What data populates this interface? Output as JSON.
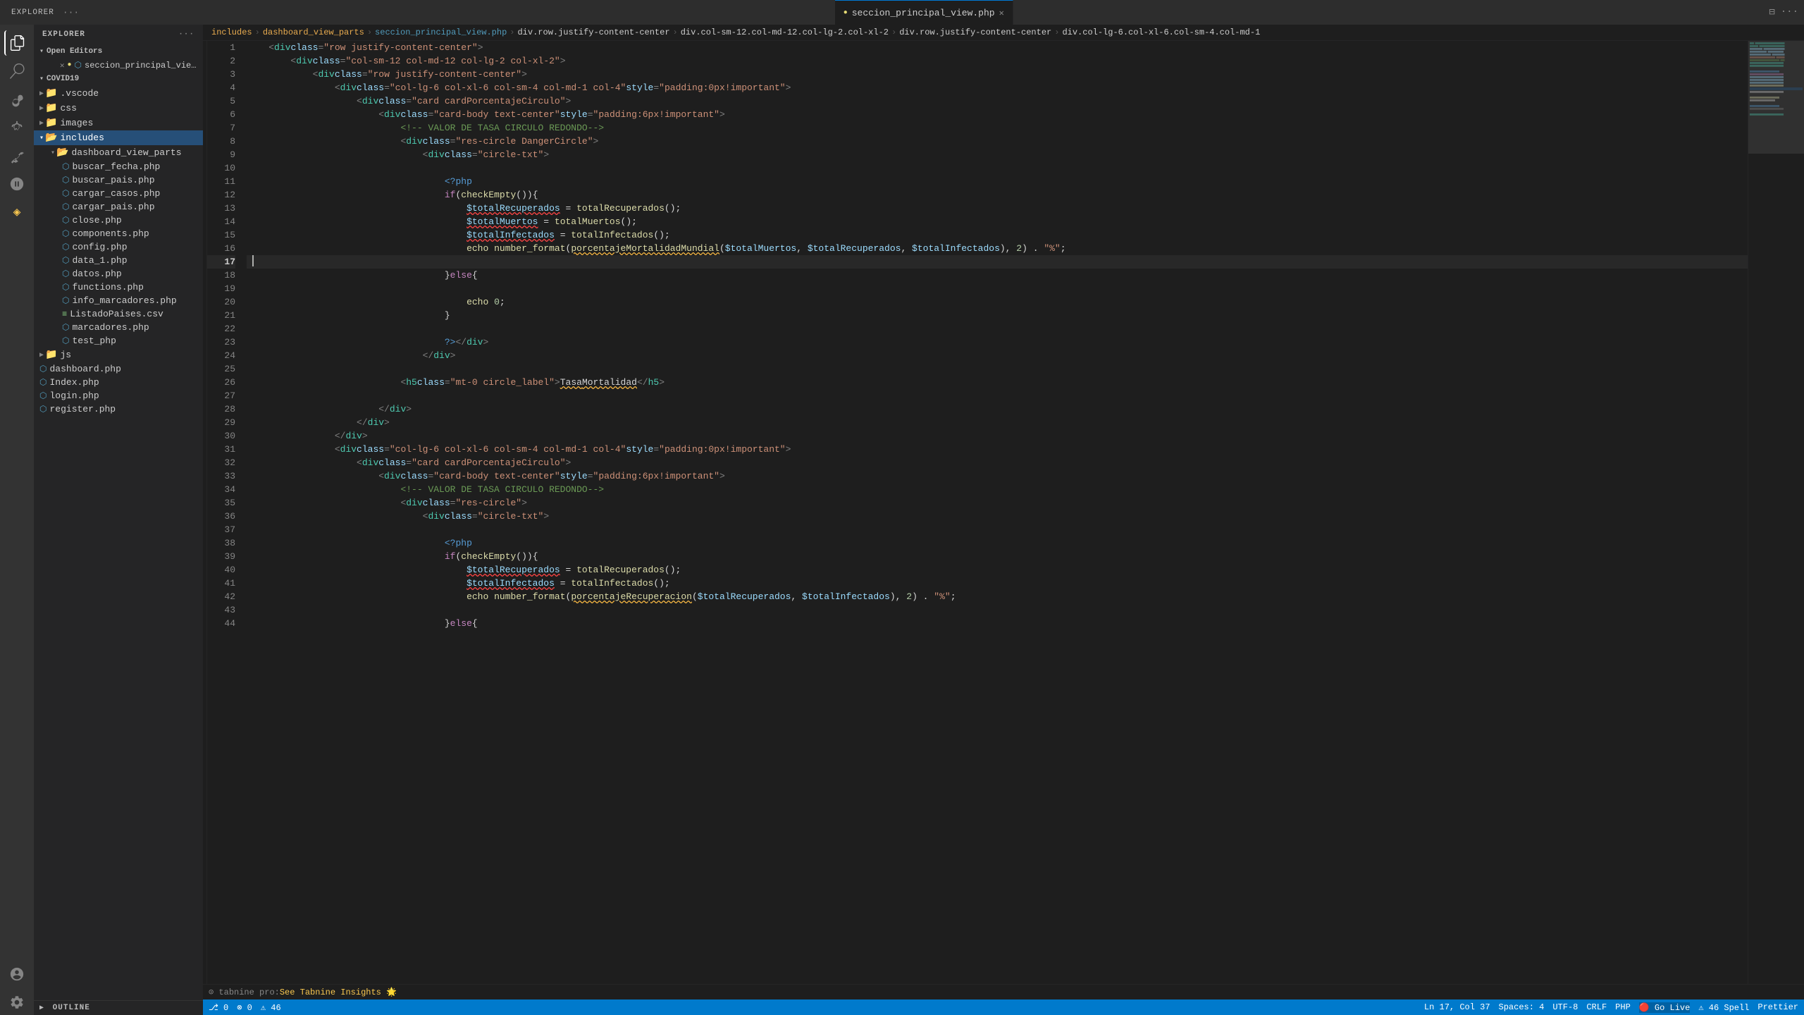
{
  "app": {
    "title": "VS Code - seccion_principal_view.php"
  },
  "activity_bar": {
    "icons": [
      {
        "name": "explorer-icon",
        "symbol": "⎘",
        "label": "Explorer",
        "active": true
      },
      {
        "name": "search-icon",
        "symbol": "🔍",
        "label": "Search"
      },
      {
        "name": "source-control-icon",
        "symbol": "⑂",
        "label": "Source Control"
      },
      {
        "name": "debug-icon",
        "symbol": "▶",
        "label": "Run and Debug"
      },
      {
        "name": "extensions-icon",
        "symbol": "⊞",
        "label": "Extensions"
      },
      {
        "name": "remote-explorer-icon",
        "symbol": "⌖",
        "label": "Remote Explorer"
      },
      {
        "name": "tabnine-icon",
        "symbol": "◈",
        "label": "Tabnine"
      }
    ],
    "bottom_icons": [
      {
        "name": "accounts-icon",
        "symbol": "👤",
        "label": "Accounts"
      },
      {
        "name": "settings-icon",
        "symbol": "⚙",
        "label": "Settings"
      }
    ]
  },
  "sidebar": {
    "header": "Explorer",
    "open_editors_label": "Open Editors",
    "open_editors": [
      {
        "name": "seccion_principal_view.php",
        "modified": true,
        "icon": "php-file-icon",
        "color": "#519aba"
      }
    ],
    "project_label": "COVID19",
    "tree": [
      {
        "indent": 0,
        "type": "folder",
        "label": ".vscode",
        "icon": "folder-icon",
        "expanded": false
      },
      {
        "indent": 0,
        "type": "folder",
        "label": "css",
        "icon": "folder-icon",
        "expanded": false
      },
      {
        "indent": 0,
        "type": "folder",
        "label": "images",
        "icon": "folder-icon",
        "expanded": false
      },
      {
        "indent": 0,
        "type": "folder",
        "label": "includes",
        "icon": "folder-icon",
        "expanded": true,
        "active": true
      },
      {
        "indent": 1,
        "type": "folder",
        "label": "dashboard_view_parts",
        "icon": "folder-icon",
        "expanded": true
      },
      {
        "indent": 2,
        "type": "file",
        "label": "buscar_fecha.php",
        "icon": "php-file-icon",
        "color": "#519aba"
      },
      {
        "indent": 2,
        "type": "file",
        "label": "buscar_pais.php",
        "icon": "php-file-icon",
        "color": "#519aba"
      },
      {
        "indent": 2,
        "type": "file",
        "label": "cargar_casos.php",
        "icon": "php-file-icon",
        "color": "#519aba"
      },
      {
        "indent": 2,
        "type": "file",
        "label": "cargar_pais.php",
        "icon": "php-file-icon",
        "color": "#519aba"
      },
      {
        "indent": 2,
        "type": "file",
        "label": "close.php",
        "icon": "php-file-icon",
        "color": "#519aba"
      },
      {
        "indent": 2,
        "type": "file",
        "label": "components.php",
        "icon": "php-file-icon",
        "color": "#519aba"
      },
      {
        "indent": 2,
        "type": "file",
        "label": "config.php",
        "icon": "php-file-icon",
        "color": "#519aba"
      },
      {
        "indent": 2,
        "type": "file",
        "label": "data_1.php",
        "icon": "php-file-icon",
        "color": "#519aba"
      },
      {
        "indent": 2,
        "type": "file",
        "label": "datos.php",
        "icon": "php-file-icon",
        "color": "#519aba"
      },
      {
        "indent": 2,
        "type": "file",
        "label": "functions.php",
        "icon": "php-file-icon",
        "color": "#519aba"
      },
      {
        "indent": 2,
        "type": "file",
        "label": "info_marcadores.php",
        "icon": "php-file-icon",
        "color": "#519aba"
      },
      {
        "indent": 2,
        "type": "file",
        "label": "ListadoPaises.csv",
        "icon": "csv-file-icon",
        "color": "#89d185"
      },
      {
        "indent": 2,
        "type": "file",
        "label": "marcadores.php",
        "icon": "php-file-icon",
        "color": "#519aba"
      },
      {
        "indent": 2,
        "type": "file",
        "label": "test_php",
        "icon": "php-file-icon",
        "color": "#519aba"
      },
      {
        "indent": 0,
        "type": "folder",
        "label": "js",
        "icon": "folder-icon",
        "expanded": false
      },
      {
        "indent": 0,
        "type": "file",
        "label": "dashboard.php",
        "icon": "php-file-icon",
        "color": "#519aba"
      },
      {
        "indent": 0,
        "type": "file",
        "label": "Index.php",
        "icon": "php-file-icon",
        "color": "#519aba"
      },
      {
        "indent": 0,
        "type": "file",
        "label": "login.php",
        "icon": "php-file-icon",
        "color": "#519aba"
      },
      {
        "indent": 0,
        "type": "file",
        "label": "register.php",
        "icon": "php-file-icon",
        "color": "#519aba"
      }
    ],
    "outline_label": "Outline"
  },
  "breadcrumb": {
    "items": [
      {
        "label": "includes",
        "type": "folder"
      },
      {
        "label": "dashboard_view_parts",
        "type": "folder"
      },
      {
        "label": "seccion_principal_view.php",
        "type": "file"
      },
      {
        "label": "div.row.justify-content-center",
        "type": "element"
      },
      {
        "label": "div.col-sm-12.col-md-12.col-lg-2.col-xl-2",
        "type": "element"
      },
      {
        "label": "div.row.justify-content-center",
        "type": "element"
      },
      {
        "label": "div.col-lg-6.col-xl-6.col-sm-4.col-md-1",
        "type": "element"
      }
    ]
  },
  "tab": {
    "label": "seccion_principal_view.php",
    "modified": true
  },
  "code": {
    "lines": [
      {
        "num": 1,
        "content": "    <div class=\"row justify-content-center\">"
      },
      {
        "num": 2,
        "content": "        <div class=\"col-sm-12 col-md-12 col-lg-2 col-xl-2\">"
      },
      {
        "num": 3,
        "content": "            <div class=\"row justify-content-center\">"
      },
      {
        "num": 4,
        "content": "                <div class=\"col-lg-6 col-xl-6 col-sm-4 col-md-1 col-4\" style=\"padding:0px!important\">"
      },
      {
        "num": 5,
        "content": "                    <div class=\"card cardPorcentajeCirculo\">"
      },
      {
        "num": 6,
        "content": "                        <div class=\"card-body text-center\" style=\"padding:6px!important\">"
      },
      {
        "num": 7,
        "content": "                            <!-- VALOR DE TASA CIRCULO REDONDO-->"
      },
      {
        "num": 8,
        "content": "                            <div class=\"res-circle DangerCircle\">"
      },
      {
        "num": 9,
        "content": "                                <div class=\"circle-txt\">"
      },
      {
        "num": 10,
        "content": ""
      },
      {
        "num": 11,
        "content": "                                    <?php"
      },
      {
        "num": 12,
        "content": "                                    if(checkEmpty()){"
      },
      {
        "num": 13,
        "content": "                                        $totalRecuperados = totalRecuperados();"
      },
      {
        "num": 14,
        "content": "                                        $totalMuertos = totalMuertos();"
      },
      {
        "num": 15,
        "content": "                                        $totalInfectados = totalInfectados();"
      },
      {
        "num": 16,
        "content": "                                        echo number_format(porcentajeMortalidadMundial($totalMuertos, $totalRecuperados, $totalInfectados), 2) . \"%\";"
      },
      {
        "num": 17,
        "content": ""
      },
      {
        "num": 18,
        "content": "                                    }else{"
      },
      {
        "num": 19,
        "content": ""
      },
      {
        "num": 20,
        "content": "                                        echo 0;"
      },
      {
        "num": 21,
        "content": "                                    }"
      },
      {
        "num": 22,
        "content": ""
      },
      {
        "num": 23,
        "content": "                                    ?>"
      },
      {
        "num": 24,
        "content": "                                </div>"
      },
      {
        "num": 25,
        "content": ""
      },
      {
        "num": 26,
        "content": "                            <h5 class=\"mt-0 circle_label\">Tasa Mortalidad</h5>"
      },
      {
        "num": 27,
        "content": ""
      },
      {
        "num": 28,
        "content": "                        </div>"
      },
      {
        "num": 29,
        "content": "                    </div>"
      },
      {
        "num": 30,
        "content": "                </div>"
      },
      {
        "num": 31,
        "content": "                <div class=\"col-lg-6 col-xl-6 col-sm-4 col-md-1 col-4\" style=\"padding:0px!important\">"
      },
      {
        "num": 32,
        "content": "                    <div class=\"card cardPorcentajeCirculo\">"
      },
      {
        "num": 33,
        "content": "                        <div class=\"card-body text-center\" style=\"padding:6px!important\">"
      },
      {
        "num": 34,
        "content": "                            <!-- VALOR DE TASA CIRCULO REDONDO-->"
      },
      {
        "num": 35,
        "content": "                            <div class=\"res-circle\">"
      },
      {
        "num": 36,
        "content": "                                <div class=\"circle-txt\">"
      },
      {
        "num": 37,
        "content": ""
      },
      {
        "num": 38,
        "content": "                                    <?php"
      },
      {
        "num": 39,
        "content": "                                    if(checkEmpty()){"
      },
      {
        "num": 40,
        "content": "                                        $totalRecuperados = totalRecuperados();"
      },
      {
        "num": 41,
        "content": "                                        $totalInfectados = totalInfectados();"
      },
      {
        "num": 42,
        "content": "                                        echo number_format(porcentajeRecuperacion($totalRecuperados, $totalInfectados), 2) . \"%\";"
      },
      {
        "num": 43,
        "content": ""
      },
      {
        "num": 44,
        "content": "                                    }else{"
      }
    ],
    "current_line": 17
  },
  "status_bar": {
    "left": [
      {
        "label": "⎇ 0",
        "name": "git-branch"
      },
      {
        "label": "⚠ 0",
        "name": "errors"
      },
      {
        "label": "△ 46",
        "name": "warnings"
      }
    ],
    "right": [
      {
        "label": "Ln 17, Col 37",
        "name": "cursor-position"
      },
      {
        "label": "Spaces: 4",
        "name": "indentation"
      },
      {
        "label": "UTF-8",
        "name": "encoding"
      },
      {
        "label": "CRLF",
        "name": "line-endings"
      },
      {
        "label": "PHP",
        "name": "language-mode"
      },
      {
        "label": "Go Live",
        "name": "go-live"
      },
      {
        "label": "△ 46 Spell",
        "name": "spell-check"
      },
      {
        "label": "Prettier",
        "name": "prettier"
      }
    ]
  },
  "tabnine": {
    "prefix": "⊙ tabnine pro:",
    "cta": "See Tabnine Insights 🌟"
  }
}
